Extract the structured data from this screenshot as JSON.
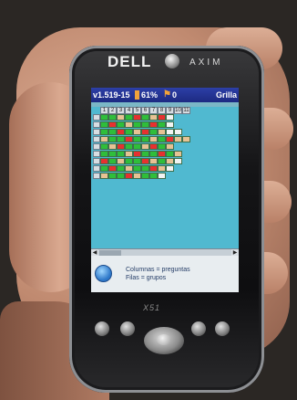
{
  "device": {
    "brand": "DELL",
    "model_line": "AXIM",
    "model_mark": "X51"
  },
  "status_bar": {
    "version": "v1.519-15",
    "battery": "61%",
    "signal": "0",
    "title": "Grilla"
  },
  "grid": {
    "columns": [
      "1",
      "2",
      "3",
      "4",
      "5",
      "6",
      "7",
      "8",
      "9",
      "10",
      "11"
    ],
    "rows": [
      [
        "g",
        "g",
        "t",
        "g",
        "r",
        "g",
        "t",
        "r",
        "w"
      ],
      [
        "g",
        "r",
        "g",
        "t",
        "g",
        "g",
        "r",
        "g",
        "w"
      ],
      [
        "g",
        "g",
        "r",
        "g",
        "t",
        "r",
        "g",
        "t",
        "w",
        "w"
      ],
      [
        "t",
        "g",
        "g",
        "r",
        "g",
        "g",
        "t",
        "g",
        "r",
        "t",
        "t"
      ],
      [
        "g",
        "t",
        "r",
        "g",
        "g",
        "t",
        "r",
        "g",
        "t"
      ],
      [
        "g",
        "g",
        "g",
        "t",
        "r",
        "g",
        "g",
        "r",
        "g",
        "t"
      ],
      [
        "r",
        "g",
        "t",
        "g",
        "g",
        "r",
        "t",
        "g",
        "t",
        "w"
      ],
      [
        "g",
        "r",
        "g",
        "t",
        "g",
        "g",
        "r",
        "t",
        "w"
      ],
      [
        "t",
        "g",
        "g",
        "r",
        "t",
        "g",
        "g",
        "w"
      ]
    ],
    "cell_colors": {
      "g": "#2fbe3a",
      "r": "#e63030",
      "t": "#e7c294",
      "w": "#f2f4f3"
    }
  },
  "legend": {
    "line1": "Columnas = preguntas",
    "line2": "Filas = grupos"
  },
  "icons": {
    "battery": "battery-icon",
    "signal": "signal-icon",
    "legend": "app-logo-icon"
  }
}
